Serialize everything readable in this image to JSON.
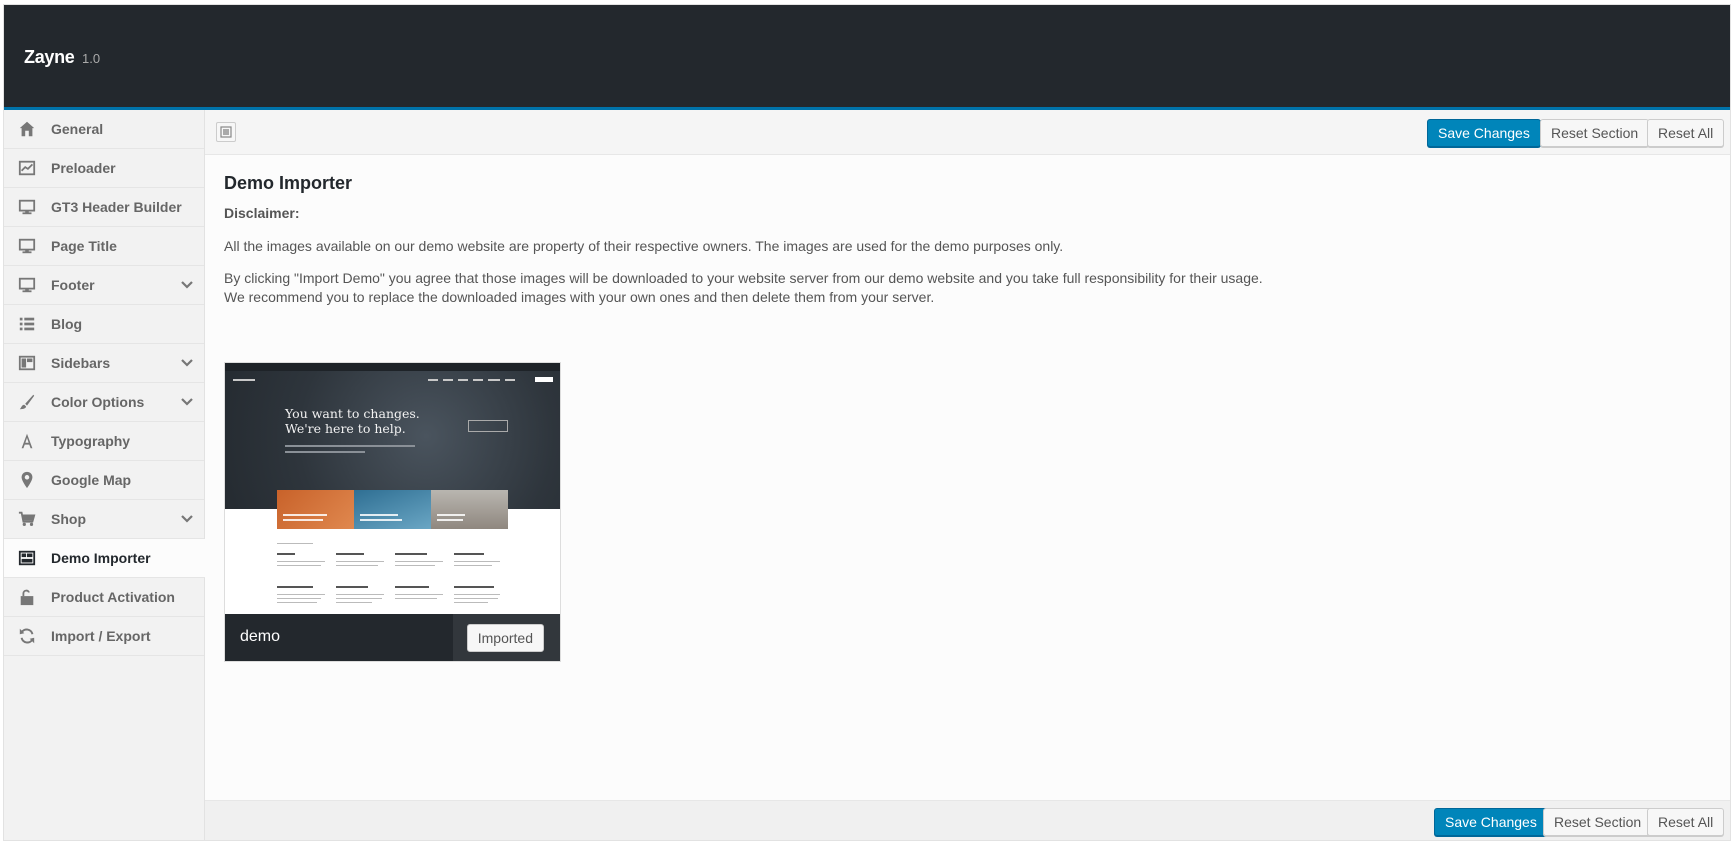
{
  "header": {
    "brand": "Zayne",
    "version": "1.0"
  },
  "sidebar": {
    "items": [
      {
        "label": "General",
        "icon": "home-icon"
      },
      {
        "label": "Preloader",
        "icon": "chart-icon"
      },
      {
        "label": "GT3 Header Builder",
        "icon": "monitor-icon"
      },
      {
        "label": "Page Title",
        "icon": "monitor-icon"
      },
      {
        "label": "Footer",
        "icon": "monitor-icon",
        "expandable": true
      },
      {
        "label": "Blog",
        "icon": "list-icon"
      },
      {
        "label": "Sidebars",
        "icon": "layout-icon",
        "expandable": true
      },
      {
        "label": "Color Options",
        "icon": "brush-icon",
        "expandable": true
      },
      {
        "label": "Typography",
        "icon": "font-icon"
      },
      {
        "label": "Google Map",
        "icon": "map-pin-icon"
      },
      {
        "label": "Shop",
        "icon": "cart-icon",
        "expandable": true
      },
      {
        "label": "Demo Importer",
        "icon": "layout-icon",
        "active": true
      },
      {
        "label": "Product Activation",
        "icon": "unlock-icon"
      },
      {
        "label": "Import / Export",
        "icon": "refresh-icon"
      }
    ]
  },
  "toolbar": {
    "save_label": "Save Changes",
    "reset_section_label": "Reset Section",
    "reset_all_label": "Reset All"
  },
  "content": {
    "title": "Demo Importer",
    "disclaimer_title": "Disclaimer:",
    "para1": "All the images available on our demo website are property of their respective owners. The images are used for the demo purposes only.",
    "para2_line1": "By clicking \"Import Demo\" you agree that those images will be downloaded to your website server from our demo website and you take full responsibility for their usage.",
    "para2_line2": "We recommend you to replace the downloaded images with your own ones and then delete them from your server."
  },
  "demo": {
    "name": "demo",
    "status_label": "Imported",
    "preview_headline_1": "You want to changes.",
    "preview_headline_2": "We're here to help."
  },
  "colors": {
    "header_bg": "#23282d",
    "accent": "#0085ba",
    "sidebar_bg": "#f2f2f2"
  }
}
